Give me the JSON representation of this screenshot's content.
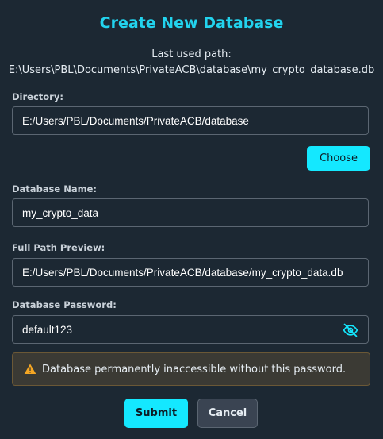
{
  "dialog": {
    "title": "Create New Database",
    "last_used_label": "Last used path:",
    "last_used_path": "E:\\Users\\PBL\\Documents\\PrivateACB\\database\\my_crypto_database.db"
  },
  "directory": {
    "label": "Directory:",
    "value": "E:/Users/PBL/Documents/PrivateACB/database",
    "choose_label": "Choose"
  },
  "db_name": {
    "label": "Database Name:",
    "value": "my_crypto_data"
  },
  "preview": {
    "label": "Full Path Preview:",
    "value": "E:/Users/PBL/Documents/PrivateACB/database/my_crypto_data.db"
  },
  "password": {
    "label": "Database Password:",
    "value": "default123",
    "toggle_icon": "eye-off-icon"
  },
  "warning": {
    "icon": "warning-icon",
    "text": "Database permanently inaccessible without this password."
  },
  "actions": {
    "submit_label": "Submit",
    "cancel_label": "Cancel"
  },
  "colors": {
    "accent": "#14e8ff",
    "background": "#1c2833",
    "warning_icon": "#f5a623"
  }
}
